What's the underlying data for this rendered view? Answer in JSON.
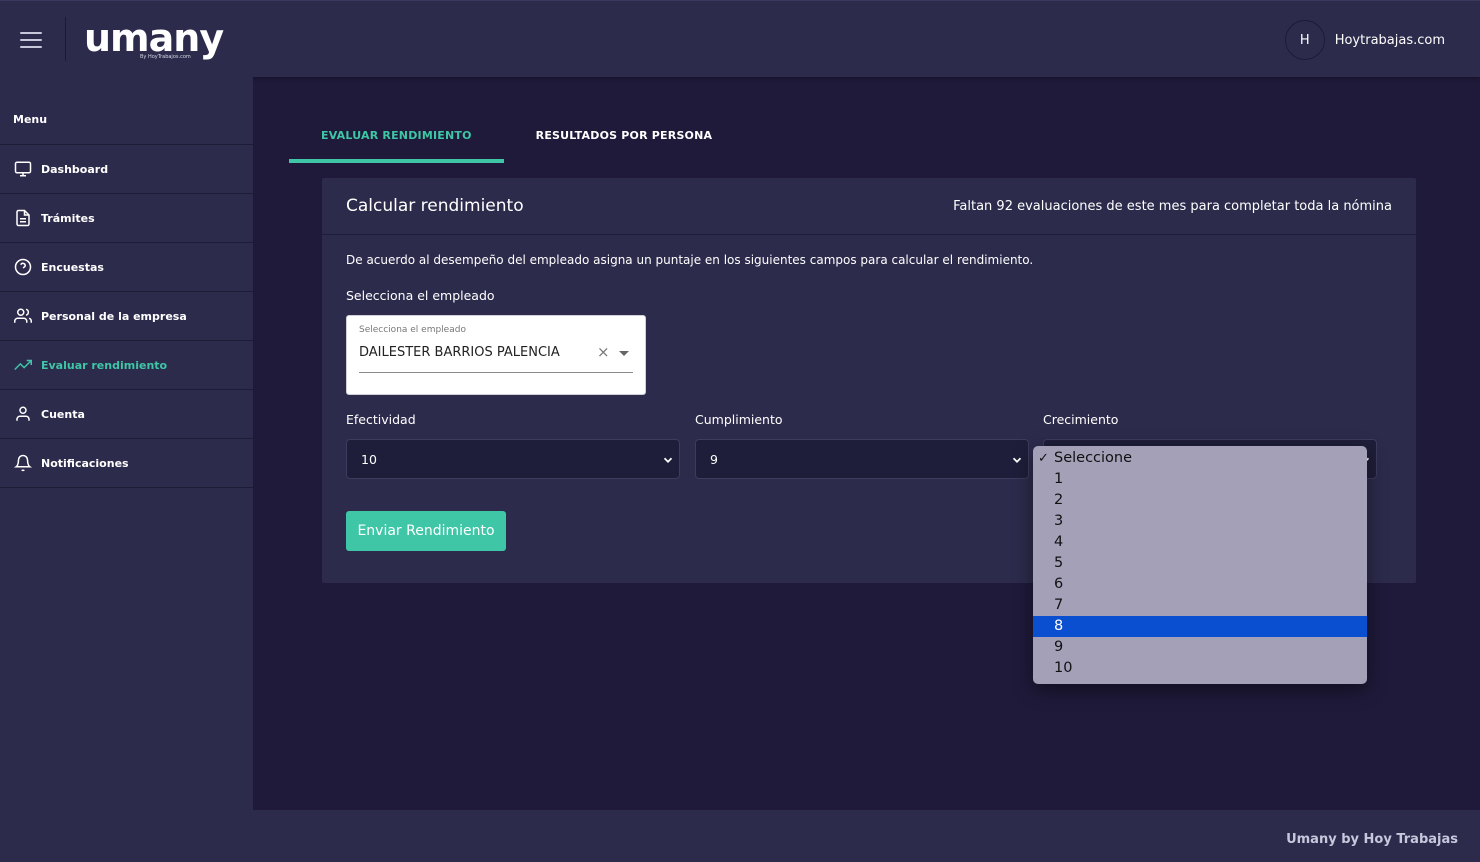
{
  "header": {
    "logo": "umany",
    "logo_sub": "By HoyTrabajos.com",
    "user_initial": "H",
    "user_name": "Hoytrabajas.com"
  },
  "sidebar": {
    "title": "Menu",
    "items": [
      {
        "label": "Dashboard",
        "icon": "monitor-icon"
      },
      {
        "label": "Trámites",
        "icon": "document-icon"
      },
      {
        "label": "Encuestas",
        "icon": "question-circle-icon"
      },
      {
        "label": "Personal de la empresa",
        "icon": "people-icon"
      },
      {
        "label": "Evaluar rendimiento",
        "icon": "trending-up-icon",
        "active": true
      },
      {
        "label": "Cuenta",
        "icon": "person-icon"
      },
      {
        "label": "Notificaciones",
        "icon": "bell-icon"
      }
    ]
  },
  "tabs": [
    {
      "label": "EVALUAR RENDIMIENTO",
      "active": true
    },
    {
      "label": "RESULTADOS POR PERSONA",
      "active": false
    }
  ],
  "card": {
    "title": "Calcular rendimiento",
    "note": "Faltan 92 evaluaciones de este mes para completar toda la nómina",
    "description": "De acuerdo al desempeño del empleado asigna un puntaje en los siguientes campos para calcular el rendimiento.",
    "employee_label": "Selecciona el empleado",
    "employee_field": {
      "label": "Selecciona el empleado",
      "value": "DAILESTER BARRIOS PALENCIA"
    },
    "selects": [
      {
        "label": "Efectividad",
        "value": "10"
      },
      {
        "label": "Cumplimiento",
        "value": "9"
      },
      {
        "label": "Crecimiento",
        "value": "Seleccione"
      }
    ],
    "submit_label": "Enviar Rendimiento"
  },
  "dropdown": {
    "options": [
      "Seleccione",
      "1",
      "2",
      "3",
      "4",
      "5",
      "6",
      "7",
      "8",
      "9",
      "10"
    ],
    "checked": "Seleccione",
    "highlighted": "8"
  },
  "footer": {
    "text": "Umany by Hoy Trabajas"
  },
  "colors": {
    "accent": "#3ec6a6",
    "panel": "#2c2b4c",
    "background": "#1f1a3a",
    "highlight": "#0a4fcf"
  }
}
